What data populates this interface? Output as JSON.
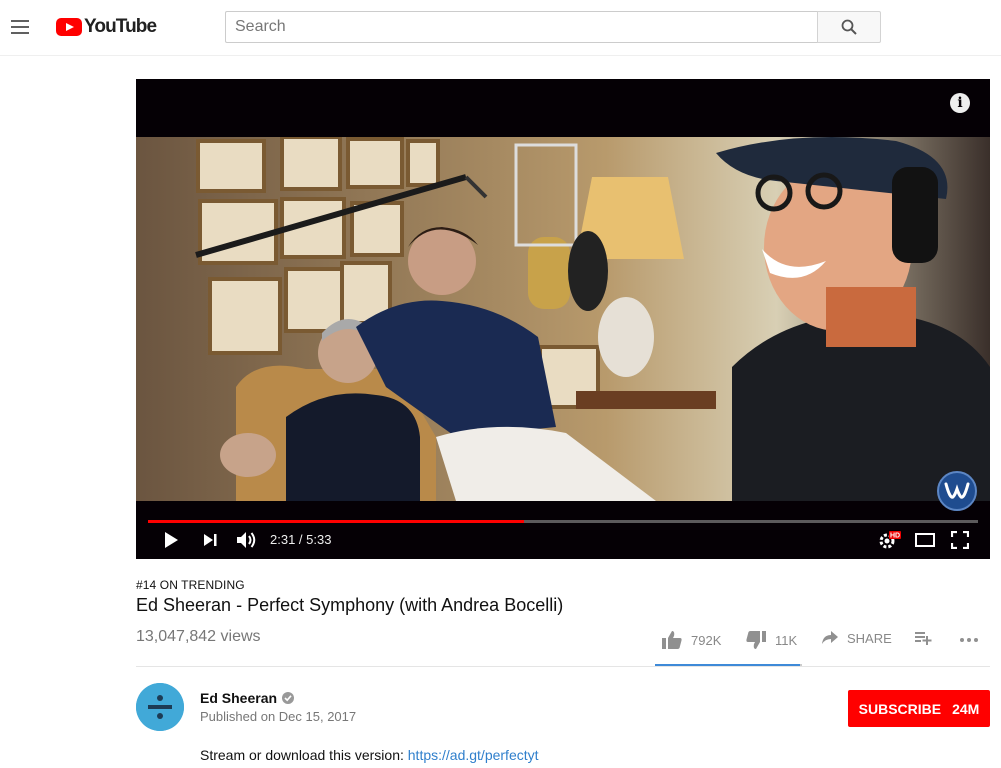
{
  "header": {
    "logo_text": "YouTube",
    "search_placeholder": "Search",
    "search_value": ""
  },
  "player": {
    "info_symbol": "i",
    "current_time": "2:31",
    "duration": "5:33",
    "time_display": "2:31 / 5:33",
    "progress_fraction": 0.453,
    "quality_badge": "HD",
    "brand_color": "#ff0000"
  },
  "video": {
    "trending_label": "#14 ON TRENDING",
    "title": "Ed Sheeran - Perfect Symphony (with Andrea Bocelli)",
    "views": "13,047,842 views"
  },
  "actions": {
    "likes": "792K",
    "dislikes": "11K",
    "share_label": "SHARE",
    "like_ratio": 0.986
  },
  "channel": {
    "name": "Ed Sheeran",
    "published": "Published on Dec 15, 2017",
    "subscribe_label": "SUBSCRIBE",
    "subscriber_count": "24M"
  },
  "description": {
    "text": "Stream or download this version: ",
    "link_text": "https://ad.gt/perfectyt"
  },
  "icons": [
    "menu-icon",
    "youtube-logo-icon",
    "search-icon",
    "info-icon",
    "play-icon",
    "next-icon",
    "volume-icon",
    "settings-icon",
    "theater-icon",
    "fullscreen-icon",
    "thumbs-up-icon",
    "thumbs-down-icon",
    "share-icon",
    "add-to-playlist-icon",
    "more-icon",
    "verified-icon",
    "warner-music-icon"
  ]
}
